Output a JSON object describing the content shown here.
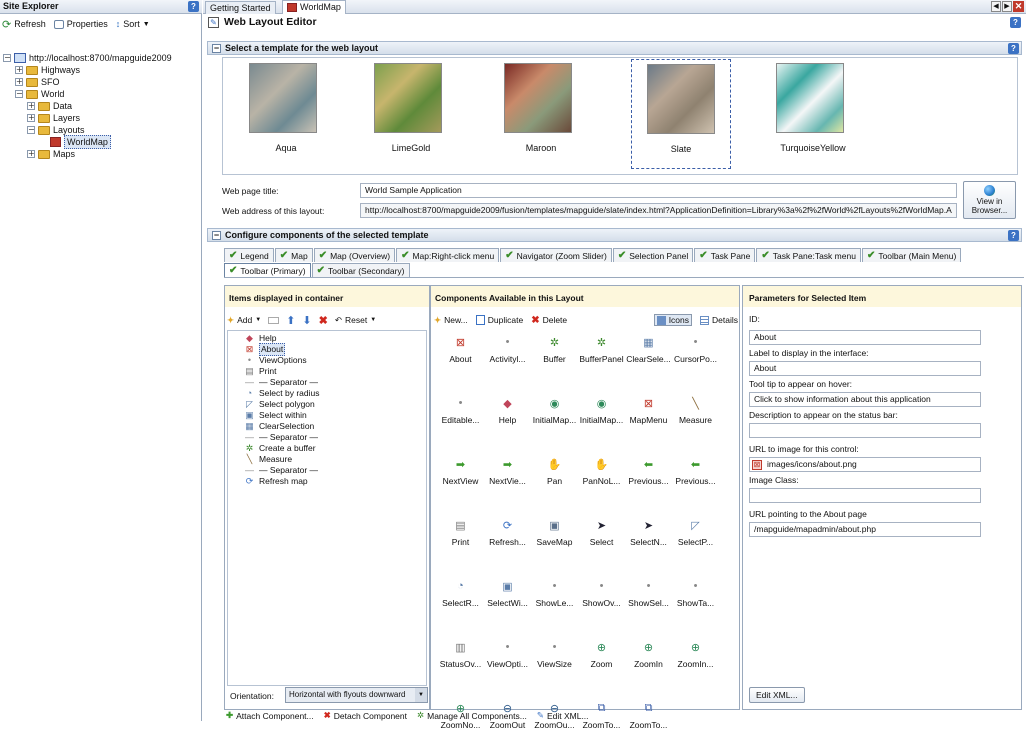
{
  "explorer": {
    "title": "Site Explorer",
    "refresh": "Refresh",
    "properties": "Properties",
    "sort": "Sort",
    "tree": [
      {
        "label": "http://localhost:8700/mapguide2009",
        "depth": 0,
        "pm": "−",
        "kind": "server"
      },
      {
        "label": "Highways",
        "depth": 1,
        "pm": "+",
        "kind": "folder"
      },
      {
        "label": "SFO",
        "depth": 1,
        "pm": "+",
        "kind": "folder"
      },
      {
        "label": "World",
        "depth": 1,
        "pm": "−",
        "kind": "folder"
      },
      {
        "label": "Data",
        "depth": 2,
        "pm": "+",
        "kind": "folder"
      },
      {
        "label": "Layers",
        "depth": 2,
        "pm": "+",
        "kind": "folder"
      },
      {
        "label": "Layouts",
        "depth": 2,
        "pm": "−",
        "kind": "folder"
      },
      {
        "label": "WorldMap",
        "depth": 3,
        "pm": "",
        "kind": "layout",
        "selected": true
      },
      {
        "label": "Maps",
        "depth": 2,
        "pm": "+",
        "kind": "folder"
      }
    ]
  },
  "doc_tabs": {
    "tab1": "Getting Started",
    "tab2": "WorldMap"
  },
  "editor": {
    "title": "Web Layout Editor",
    "template_header": "Select a template for the web layout",
    "templates": [
      "Aqua",
      "LimeGold",
      "Maroon",
      "Slate",
      "TurquoiseYellow"
    ],
    "web_title_label": "Web page title:",
    "web_title_value": "World Sample Application",
    "web_address_label": "Web address of this layout:",
    "web_address_value": "http://localhost:8700/mapguide2009/fusion/templates/mapguide/slate/index.html?ApplicationDefinition=Library%3a%2f%2fWorld%2fLayouts%2fWorldMap.A",
    "view_in_browser_line1": "View in",
    "view_in_browser_line2": "Browser...",
    "configure_header": "Configure components of the selected template",
    "component_tabs_row1": [
      "Legend",
      "Map",
      "Map (Overview)",
      "Map:Right-click menu",
      "Navigator (Zoom Slider)",
      "Selection Panel",
      "Task Pane",
      "Task Pane:Task menu",
      "Toolbar (Main Menu)"
    ],
    "component_tabs_row2": [
      "Toolbar (Primary)",
      "Toolbar (Secondary)"
    ]
  },
  "items_panel": {
    "title": "Items displayed in container",
    "add": "Add",
    "reset": "Reset",
    "items": [
      {
        "label": "Help",
        "glyph": "◆",
        "color": "#c0455a"
      },
      {
        "label": "About",
        "glyph": "⊠",
        "color": "#c0392b",
        "selected": true
      },
      {
        "label": "ViewOptions",
        "glyph": "•",
        "color": "#888"
      },
      {
        "label": "Print",
        "glyph": "▤",
        "color": "#777"
      },
      {
        "label": "— Separator —",
        "glyph": "—",
        "color": "#888"
      },
      {
        "label": "Select by radius",
        "glyph": "◔",
        "color": "#5a7ca8"
      },
      {
        "label": "Select polygon",
        "glyph": "◸",
        "color": "#5a7ca8"
      },
      {
        "label": "Select within",
        "glyph": "▣",
        "color": "#5a7ca8"
      },
      {
        "label": "ClearSelection",
        "glyph": "▦",
        "color": "#5a7ca8"
      },
      {
        "label": "— Separator —",
        "glyph": "—",
        "color": "#888"
      },
      {
        "label": "Create a buffer",
        "glyph": "✲",
        "color": "#3d8a2e"
      },
      {
        "label": "Measure",
        "glyph": "╲",
        "color": "#8a6b3a"
      },
      {
        "label": "— Separator —",
        "glyph": "—",
        "color": "#888"
      },
      {
        "label": "Refresh map",
        "glyph": "⟳",
        "color": "#3b72c4"
      }
    ],
    "orientation_label": "Orientation:",
    "orientation_value": "Horizontal with flyouts downward"
  },
  "components_panel": {
    "title": "Components Available in this Layout",
    "new": "New...",
    "duplicate": "Duplicate",
    "delete": "Delete",
    "icons": "Icons",
    "details": "Details",
    "components": [
      {
        "label": "About",
        "glyph": "⊠",
        "color": "#c0392b"
      },
      {
        "label": "Activityl...",
        "glyph": "•",
        "color": "#888"
      },
      {
        "label": "Buffer",
        "glyph": "✲",
        "color": "#3d8a2e"
      },
      {
        "label": "BufferPanel",
        "glyph": "✲",
        "color": "#3d8a2e"
      },
      {
        "label": "ClearSele...",
        "glyph": "▦",
        "color": "#5a7ca8"
      },
      {
        "label": "CursorPo...",
        "glyph": "•",
        "color": "#888"
      },
      {
        "label": "Editable...",
        "glyph": "•",
        "color": "#888"
      },
      {
        "label": "Help",
        "glyph": "◆",
        "color": "#c0455a"
      },
      {
        "label": "InitialMap...",
        "glyph": "◉",
        "color": "#2e8a5a"
      },
      {
        "label": "InitialMap...",
        "glyph": "◉",
        "color": "#2e8a5a"
      },
      {
        "label": "MapMenu",
        "glyph": "⊠",
        "color": "#c0392b"
      },
      {
        "label": "Measure",
        "glyph": "╲",
        "color": "#8a6b3a"
      },
      {
        "label": "NextView",
        "glyph": "➡",
        "color": "#3d9a2e"
      },
      {
        "label": "NextVie...",
        "glyph": "➡",
        "color": "#3d9a2e"
      },
      {
        "label": "Pan",
        "glyph": "✋",
        "color": "#555"
      },
      {
        "label": "PanNoL...",
        "glyph": "✋",
        "color": "#555"
      },
      {
        "label": "Previous...",
        "glyph": "⬅",
        "color": "#3d9a2e"
      },
      {
        "label": "Previous...",
        "glyph": "⬅",
        "color": "#3d9a2e"
      },
      {
        "label": "Print",
        "glyph": "▤",
        "color": "#777"
      },
      {
        "label": "Refresh...",
        "glyph": "⟳",
        "color": "#3b72c4"
      },
      {
        "label": "SaveMap",
        "glyph": "▣",
        "color": "#5a6f8a"
      },
      {
        "label": "Select",
        "glyph": "➤",
        "color": "#223"
      },
      {
        "label": "SelectN...",
        "glyph": "➤",
        "color": "#223"
      },
      {
        "label": "SelectP...",
        "glyph": "◸",
        "color": "#5a7ca8"
      },
      {
        "label": "SelectR...",
        "glyph": "◔",
        "color": "#5a7ca8"
      },
      {
        "label": "SelectWi...",
        "glyph": "▣",
        "color": "#5a7ca8"
      },
      {
        "label": "ShowLe...",
        "glyph": "•",
        "color": "#888"
      },
      {
        "label": "ShowOv...",
        "glyph": "•",
        "color": "#888"
      },
      {
        "label": "ShowSel...",
        "glyph": "•",
        "color": "#888"
      },
      {
        "label": "ShowTa...",
        "glyph": "•",
        "color": "#888"
      },
      {
        "label": "StatusOv...",
        "glyph": "▥",
        "color": "#777"
      },
      {
        "label": "ViewOpti...",
        "glyph": "•",
        "color": "#888"
      },
      {
        "label": "ViewSize",
        "glyph": "•",
        "color": "#888"
      },
      {
        "label": "Zoom",
        "glyph": "⊕",
        "color": "#2e8a5a"
      },
      {
        "label": "ZoomIn",
        "glyph": "⊕",
        "color": "#2e8a5a"
      },
      {
        "label": "ZoomIn...",
        "glyph": "⊕",
        "color": "#2e8a5a"
      },
      {
        "label": "ZoomNo...",
        "glyph": "⊕",
        "color": "#2e8a5a"
      },
      {
        "label": "ZoomOut",
        "glyph": "⊖",
        "color": "#2e5a8a"
      },
      {
        "label": "ZoomOu...",
        "glyph": "⊖",
        "color": "#2e5a8a"
      },
      {
        "label": "ZoomTo...",
        "glyph": "⧉",
        "color": "#3b5ea8"
      },
      {
        "label": "ZoomTo...",
        "glyph": "⧉",
        "color": "#3b5ea8"
      }
    ]
  },
  "params_panel": {
    "title": "Parameters for Selected Item",
    "id_label": "ID:",
    "id_value": "About",
    "label_label": "Label to display in the interface:",
    "label_value": "About",
    "tooltip_label": "Tool tip to appear on hover:",
    "tooltip_value": "Click to show information about this application",
    "status_label": "Description to appear on the status bar:",
    "status_value": "",
    "url_image_label": "URL to image for this control:",
    "url_image_value": "images/icons/about.png",
    "image_class_label": "Image Class:",
    "image_class_value": "",
    "url_about_label": "URL pointing to the About page",
    "url_about_value": "/mapguide/mapadmin/about.php",
    "edit_xml": "Edit XML..."
  },
  "bottom_bar": {
    "attach": "Attach Component...",
    "detach": "Detach Component",
    "manage": "Manage All Components...",
    "edit_xml": "Edit XML..."
  }
}
